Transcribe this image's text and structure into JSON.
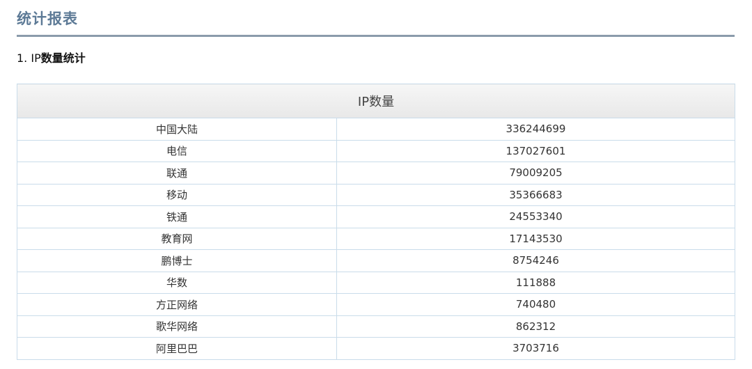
{
  "page": {
    "title": "统计报表"
  },
  "section": {
    "number": "1. IP",
    "label": "数量统计"
  },
  "table": {
    "header": "IP数量",
    "rows": [
      {
        "name": "中国大陆",
        "value": "336244699"
      },
      {
        "name": "电信",
        "value": "137027601"
      },
      {
        "name": "联通",
        "value": "79009205"
      },
      {
        "name": "移动",
        "value": "35366683"
      },
      {
        "name": "铁通",
        "value": "24553340"
      },
      {
        "name": "教育网",
        "value": "17143530"
      },
      {
        "name": "鹏博士",
        "value": "8754246"
      },
      {
        "name": "华数",
        "value": "111888"
      },
      {
        "name": "方正网络",
        "value": "740480"
      },
      {
        "name": "歌华网络",
        "value": "862312"
      },
      {
        "name": "阿里巴巴",
        "value": "3703716"
      }
    ]
  },
  "colors": {
    "title": "#5d7a96",
    "rule": "#8a9bab",
    "border": "#c9dcea"
  }
}
